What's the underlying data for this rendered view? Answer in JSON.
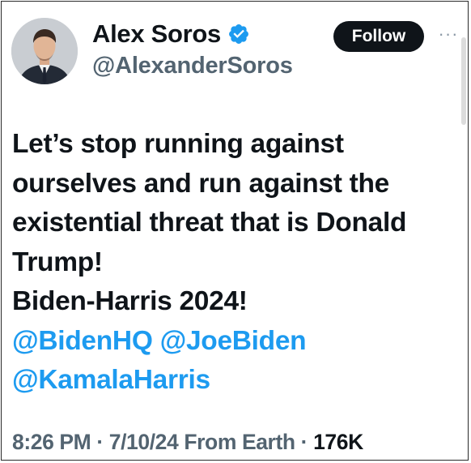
{
  "author": {
    "display_name": "Alex Soros",
    "handle": "@AlexanderSoros",
    "verified": true,
    "verified_badge_color": "#1d9bf0"
  },
  "actions": {
    "follow_label": "Follow",
    "more_label": "···"
  },
  "tweet": {
    "lines": [
      "Let’s stop running against",
      "ourselves and run against the",
      "existential threat that is Donald",
      "Trump!",
      "Biden-Harris 2024!"
    ],
    "mentions": [
      "@BidenHQ",
      "@JoeBiden",
      "@KamalaHarris"
    ]
  },
  "meta": {
    "time": "8:26 PM",
    "separator": "·",
    "date": "7/10/24",
    "source": "From Earth",
    "views": "176K"
  },
  "colors": {
    "text": "#0f1419",
    "secondary": "#536471",
    "link": "#1d9bf0"
  }
}
